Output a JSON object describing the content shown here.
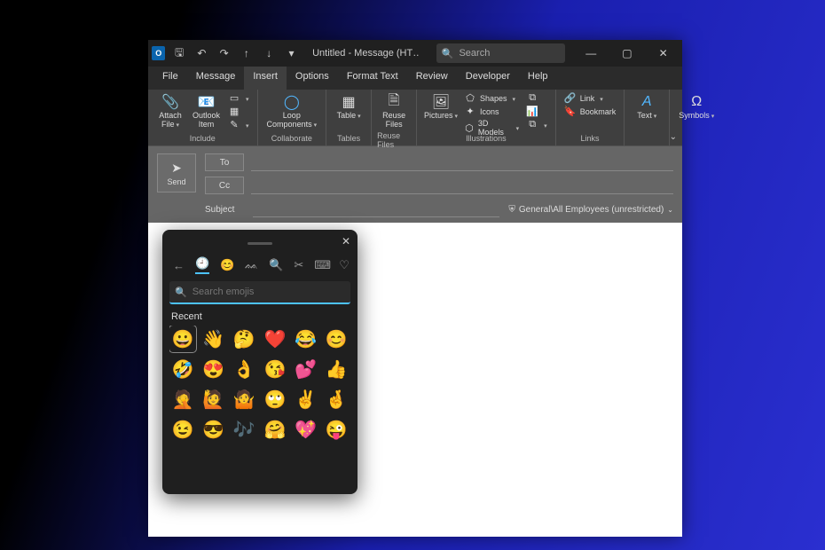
{
  "titlebar": {
    "app_icon_label": "O",
    "title": "Untitled - Message (HT…",
    "search_placeholder": "Search"
  },
  "menus": [
    "File",
    "Message",
    "Insert",
    "Options",
    "Format Text",
    "Review",
    "Developer",
    "Help"
  ],
  "active_menu": "Insert",
  "ribbon": {
    "include": {
      "attach_file": "Attach\nFile",
      "outlook_item": "Outlook\nItem",
      "label": "Include"
    },
    "collaborate": {
      "loop": "Loop\nComponents",
      "label": "Collaborate"
    },
    "tables": {
      "table": "Table",
      "label": "Tables"
    },
    "reuse": {
      "reuse_files": "Reuse\nFiles",
      "label": "Reuse Files"
    },
    "illustrations": {
      "pictures": "Pictures",
      "shapes": "Shapes",
      "icons": "Icons",
      "models": "3D Models",
      "label": "Illustrations"
    },
    "links": {
      "link": "Link",
      "bookmark": "Bookmark",
      "label": "Links"
    },
    "text": {
      "text": "Text",
      "label": ""
    },
    "symbols": {
      "symbols": "Symbols",
      "label": ""
    }
  },
  "compose": {
    "send": "Send",
    "to": "To",
    "cc": "Cc",
    "subject_label": "Subject",
    "sensitivity": "General\\All Employees (unrestricted)"
  },
  "picker": {
    "search_placeholder": "Search emojis",
    "section": "Recent",
    "tabs": [
      "←",
      "🕘",
      "😊",
      "ᨐ",
      "🔍",
      "✂",
      "⌨",
      "♡"
    ],
    "emojis": [
      "😀",
      "👋",
      "🤔",
      "❤️",
      "😂",
      "😊",
      "🤣",
      "😍",
      "👌",
      "😘",
      "💕",
      "👍",
      "🤦",
      "🙋",
      "🤷",
      "🙄",
      "✌️",
      "🤞",
      "😉",
      "😎",
      "🎶",
      "🤗",
      "💖",
      "😜"
    ]
  }
}
